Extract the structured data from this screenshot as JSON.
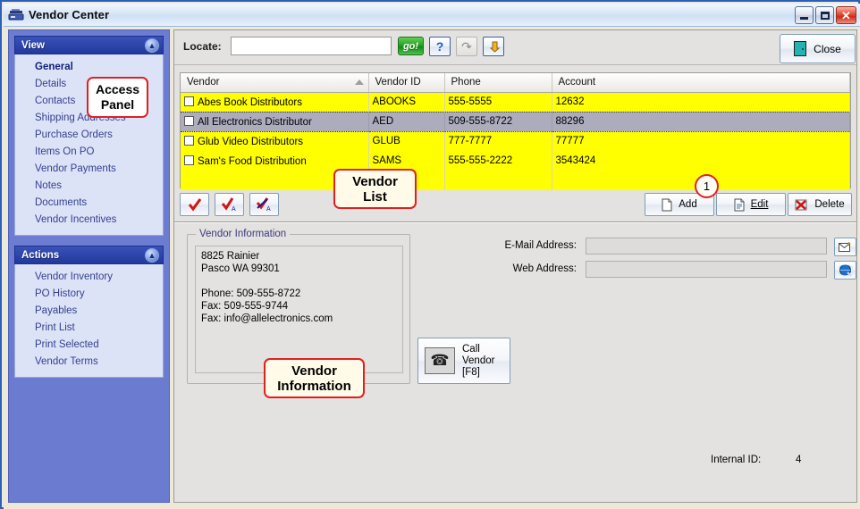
{
  "window": {
    "title": "Vendor Center",
    "icon": "vendor-window-icon",
    "minimize_label": "",
    "maximize_label": "",
    "close_label": "✕"
  },
  "navigator": {
    "groups": [
      {
        "title": "View",
        "collapse_icon": "chevron-up-icon",
        "items": [
          {
            "label": "General",
            "selected": true
          },
          {
            "label": "Details",
            "selected": false
          },
          {
            "label": "Contacts",
            "selected": false
          },
          {
            "label": "Shipping Addresses",
            "selected": false
          },
          {
            "label": "Purchase Orders",
            "selected": false
          },
          {
            "label": "Items On PO",
            "selected": false
          },
          {
            "label": "Vendor Payments",
            "selected": false
          },
          {
            "label": "Notes",
            "selected": false
          },
          {
            "label": "Documents",
            "selected": false
          },
          {
            "label": "Vendor Incentives",
            "selected": false
          }
        ]
      },
      {
        "title": "Actions",
        "collapse_icon": "chevron-up-icon",
        "items": [
          {
            "label": "Vendor Inventory",
            "selected": false
          },
          {
            "label": "PO History",
            "selected": false
          },
          {
            "label": "Payables",
            "selected": false
          },
          {
            "label": "Print List",
            "selected": false
          },
          {
            "label": "Print Selected",
            "selected": false
          },
          {
            "label": "Vendor Terms",
            "selected": false
          }
        ]
      }
    ]
  },
  "toolbar": {
    "locate_label": "Locate:",
    "locate_value": "",
    "locate_placeholder": "",
    "go_label": "go!",
    "help_icon": "question-mark-icon",
    "refresh_icon": "refresh-icon",
    "jump_icon": "yellow-arrow-icon",
    "close_label": "Close",
    "close_icon": "exit-door-icon"
  },
  "grid": {
    "columns": [
      "Vendor",
      "Vendor ID",
      "Phone",
      "Account"
    ],
    "sorted_column": "Vendor",
    "sort_icon": "sort-ascending-icon",
    "rows": [
      {
        "vendor": "Abes Book Distributors",
        "vendor_id": "ABOOKS",
        "phone": "555-5555",
        "account": "12632",
        "selected": false,
        "checked": false
      },
      {
        "vendor": "All Electronics Distributor",
        "vendor_id": "AED",
        "phone": "509-555-8722",
        "account": "88296",
        "selected": true,
        "checked": false
      },
      {
        "vendor": "Glub Video Distributors",
        "vendor_id": "GLUB",
        "phone": "777-7777",
        "account": "77777",
        "selected": false,
        "checked": false
      },
      {
        "vendor": "Sam's Food Distribution",
        "vendor_id": "SAMS",
        "phone": "555-555-2222",
        "account": "3543424",
        "selected": false,
        "checked": false
      }
    ]
  },
  "grid_buttons": {
    "check_one_icon": "red-check-icon",
    "check_all_icon": "red-check-all-icon",
    "uncheck_all_icon": "red-uncheck-all-icon",
    "add_label": "Add",
    "add_icon": "new-document-icon",
    "edit_label": "Edit",
    "edit_icon": "edit-document-icon",
    "delete_label": "Delete",
    "delete_icon": "red-x-icon"
  },
  "vendor_information": {
    "group_title": "Vendor Information",
    "text": "8825 Rainier\nPasco WA 99301\n\nPhone: 509-555-8722\nFax: 509-555-9744\nFax: info@allelectronics.com"
  },
  "contact_fields": {
    "email_label": "E-Mail Address:",
    "email_value": "",
    "email_button_icon": "send-mail-icon",
    "web_label": "Web Address:",
    "web_value": "",
    "web_button_icon": "globe-icon"
  },
  "call_vendor": {
    "label": "Call\nVendor\n[F8]",
    "icon": "telephone-icon"
  },
  "footer": {
    "internal_id_label": "Internal ID:",
    "internal_id_value": "4"
  },
  "annotations": [
    {
      "text": "Access\nPanel",
      "name": "callout-access-panel"
    },
    {
      "text": "Vendor\nList",
      "name": "callout-vendor-list"
    },
    {
      "text": "Vendor\nInformation",
      "name": "callout-vendor-information"
    },
    {
      "text": "1",
      "name": "callout-bubble-1"
    }
  ],
  "colors": {
    "row_highlight": "#ffff00",
    "row_selected": "#acacbd",
    "nav_panel": "#6c7cd0",
    "nav_header": "#22389f",
    "callout_border": "#e02020"
  }
}
